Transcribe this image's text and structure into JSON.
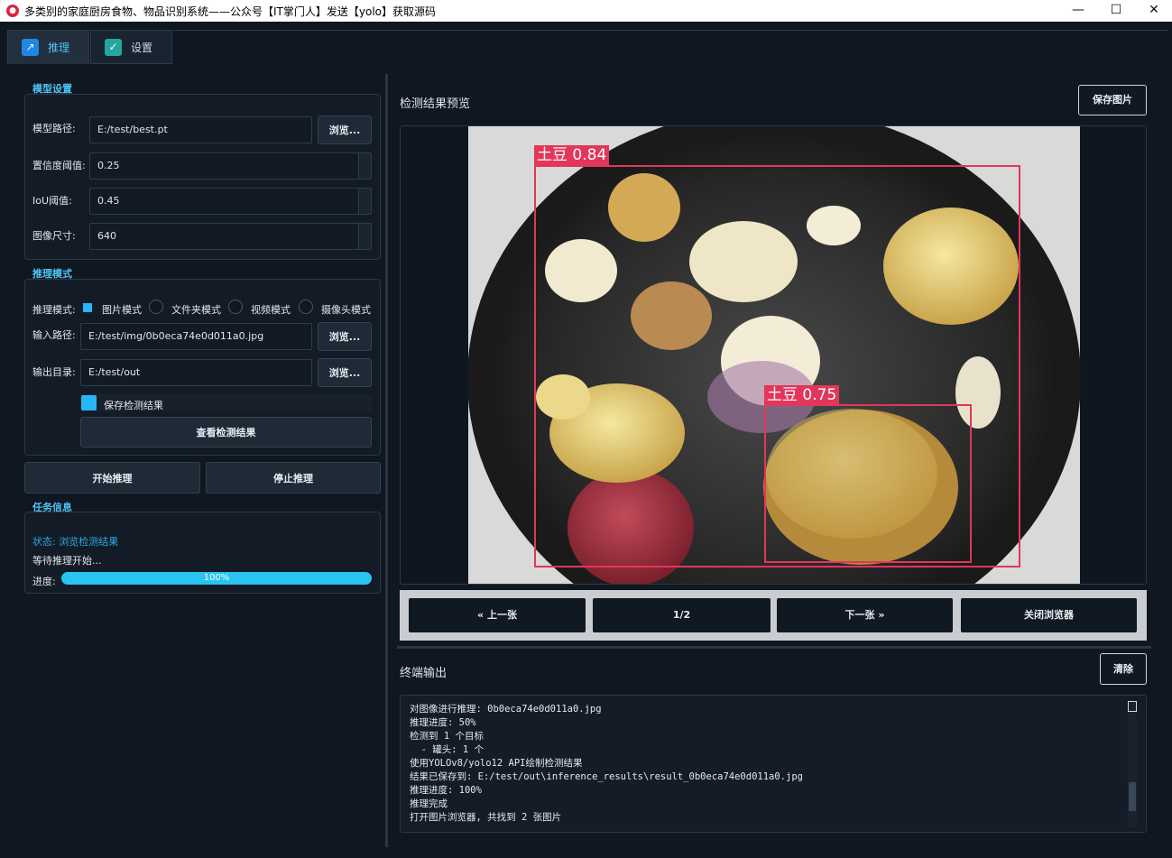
{
  "window": {
    "title": "多类别的家庭厨房食物、物品识别系统——公众号【IT掌门人】发送【yolo】获取源码",
    "minimize": "—",
    "maximize": "☐",
    "close": "✕"
  },
  "tabs": [
    {
      "label": "推理",
      "icon": "chart-icon"
    },
    {
      "label": "设置",
      "icon": "check-icon"
    }
  ],
  "model_settings": {
    "section": "模型设置",
    "model_path_label": "模型路径:",
    "model_path": "E:/test/best.pt",
    "browse": "浏览...",
    "conf_label": "置信度阈值:",
    "conf": "0.25",
    "iou_label": "IoU阈值:",
    "iou": "0.45",
    "imgsz_label": "图像尺寸:",
    "imgsz": "640"
  },
  "inference_mode": {
    "section": "推理模式",
    "mode_label": "推理模式:",
    "modes": [
      "图片模式",
      "文件夹模式",
      "视频模式",
      "摄像头模式"
    ],
    "input_label": "输入路径:",
    "input": "E:/test/img/0b0eca74e0d011a0.jpg",
    "output_label": "输出目录:",
    "output": "E:/test/out",
    "browse": "浏览...",
    "save_results": "保存检测结果",
    "view_results": "查看检测结果"
  },
  "actions": {
    "start": "开始推理",
    "stop": "停止推理"
  },
  "task_info": {
    "section": "任务信息",
    "status": "状态: 浏览检测结果",
    "waiting": "等待推理开始...",
    "progress_label": "进度:",
    "progress_text": "100%",
    "progress_value": 1.0
  },
  "preview": {
    "title": "检测结果预览",
    "save_image": "保存图片",
    "detections": [
      {
        "label": "土豆 0.84"
      },
      {
        "label": "土豆 0.75"
      }
    ],
    "prev": "« 上一张",
    "page": "1/2",
    "next": "下一张 »",
    "close_browser": "关闭浏览器"
  },
  "terminal": {
    "title": "终端输出",
    "clear": "清除",
    "lines": [
      "对图像进行推理: 0b0eca74e0d011a0.jpg",
      "推理进度: 50%",
      "检测到 1 个目标",
      "  - 罐头: 1 个",
      "使用YOLOv8/yolo12 API绘制检测结果",
      "结果已保存到: E:/test/out\\inference_results\\result_0b0eca74e0d011a0.jpg",
      "推理进度: 100%",
      "推理完成",
      "打开图片浏览器, 共找到 2 张图片"
    ]
  },
  "colors": {
    "accent": "#4fc3f7",
    "box": "#e2365b"
  }
}
